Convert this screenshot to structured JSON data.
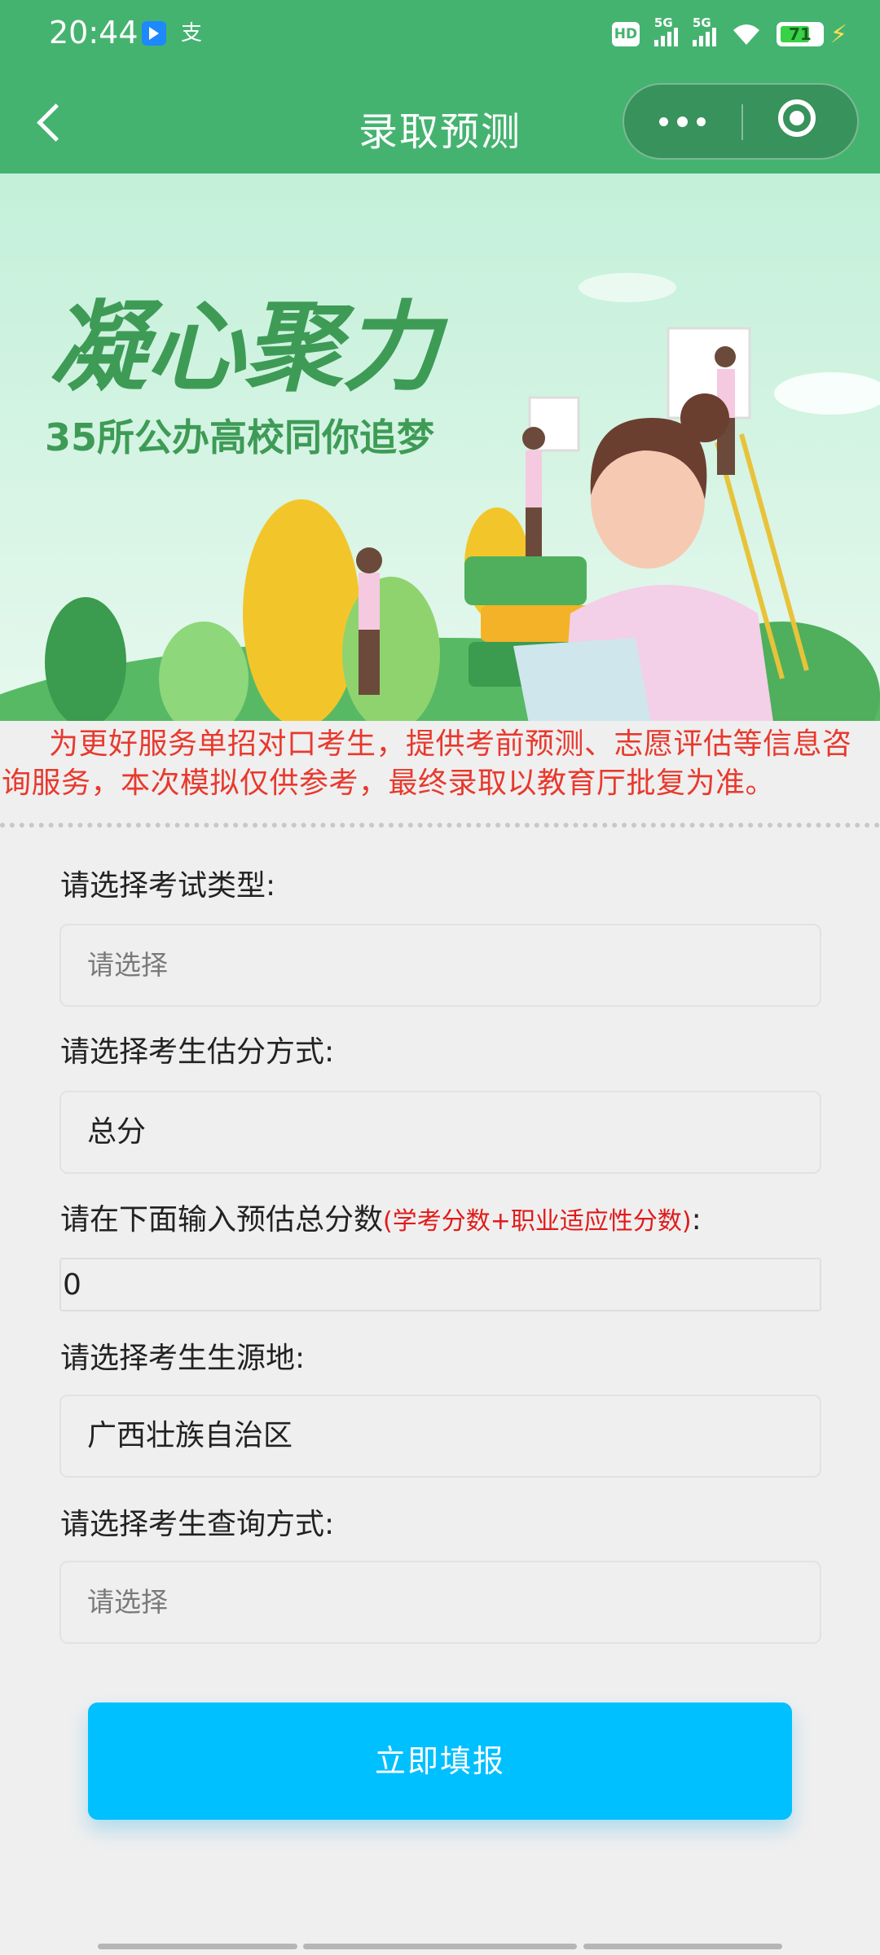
{
  "status_bar": {
    "time": "20:44",
    "app_icon_2_glyph": "支",
    "hd_label": "HD",
    "network_1": "5G",
    "network_2": "5G",
    "battery_level": "71",
    "icons": [
      "app-notification-icon",
      "alipay-icon",
      "hd-voice-icon",
      "signal-5g-icon",
      "signal-5g-icon",
      "wifi-icon",
      "battery-icon",
      "charging-icon"
    ]
  },
  "nav": {
    "title": "录取预测",
    "icons": [
      "back-chevron-icon",
      "more-dots-icon",
      "close-target-icon"
    ]
  },
  "banner": {
    "headline": "凝心聚力",
    "subline": "35所公办高校同你追梦",
    "colors": {
      "bg_top": "#bdeed3",
      "headline": "#3e9b56"
    }
  },
  "notice": {
    "text": "为更好服务单招对口考生，提供考前预测、志愿评估等信息咨询服务，本次模拟仅供参考，最终录取以教育厅批复为准。"
  },
  "form": {
    "exam_type_label": "请选择考试类型:",
    "exam_type_value": "请选择",
    "score_method_label": "请选择考生估分方式:",
    "score_method_value": "总分",
    "score_input_label": "请在下面输入预估总分数",
    "score_input_hint": "(学考分数+职业适应性分数)",
    "score_input_colon": ":",
    "score_input_value": "0",
    "origin_label": "请选择考生生源地:",
    "origin_value": "广西壮族自治区",
    "query_method_label": "请选择考生查询方式:",
    "query_method_value": "请选择",
    "submit_label": "立即填报"
  },
  "colors": {
    "brand_green": "#45b370",
    "notice_red": "#e8392d",
    "submit_blue": "#00c0ff"
  }
}
